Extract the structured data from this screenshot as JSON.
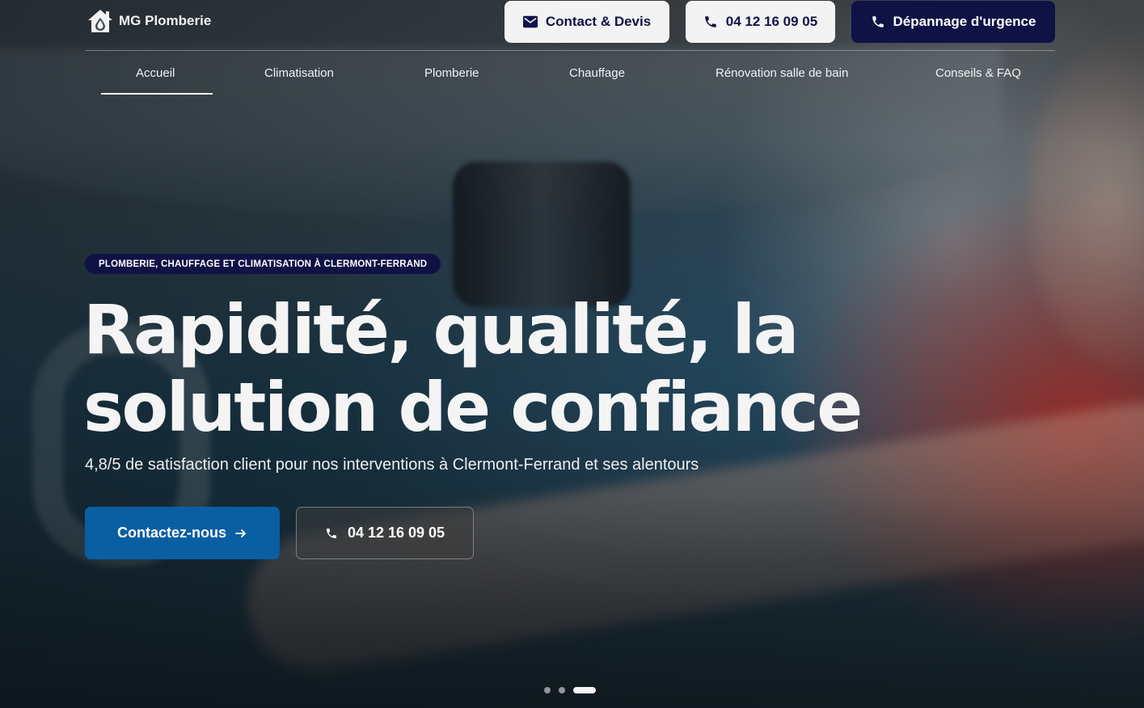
{
  "brand": {
    "name": "MG Plomberie",
    "logo_icon": "house-drop-icon"
  },
  "header": {
    "contact_label": "Contact & Devis",
    "phone_label": "04 12 16 09 05",
    "urgence_label": "Dépannage d'urgence"
  },
  "nav": {
    "items": [
      {
        "label": "Accueil",
        "active": true
      },
      {
        "label": "Climatisation"
      },
      {
        "label": "Plomberie"
      },
      {
        "label": "Chauffage"
      },
      {
        "label": "Rénovation salle de bain"
      },
      {
        "label": "Conseils & FAQ"
      }
    ]
  },
  "hero": {
    "badge": "PLOMBERIE, CHAUFFAGE ET CLIMATISATION À CLERMONT-FERRAND",
    "headline_line1": "Rapidité, qualité, la",
    "headline_line2": "solution de confiance",
    "subline": "4,8/5 de satisfaction client pour nos interventions à Clermont-Ferrand et ses alentours",
    "cta_primary": "Contactez-nous",
    "cta_phone": "04 12 16 09 05"
  },
  "slider": {
    "count": 3,
    "active_index": 2
  },
  "colors": {
    "navy": "#0f1245",
    "accent_blue": "#0a5fa3",
    "light": "#f3f3f3"
  }
}
